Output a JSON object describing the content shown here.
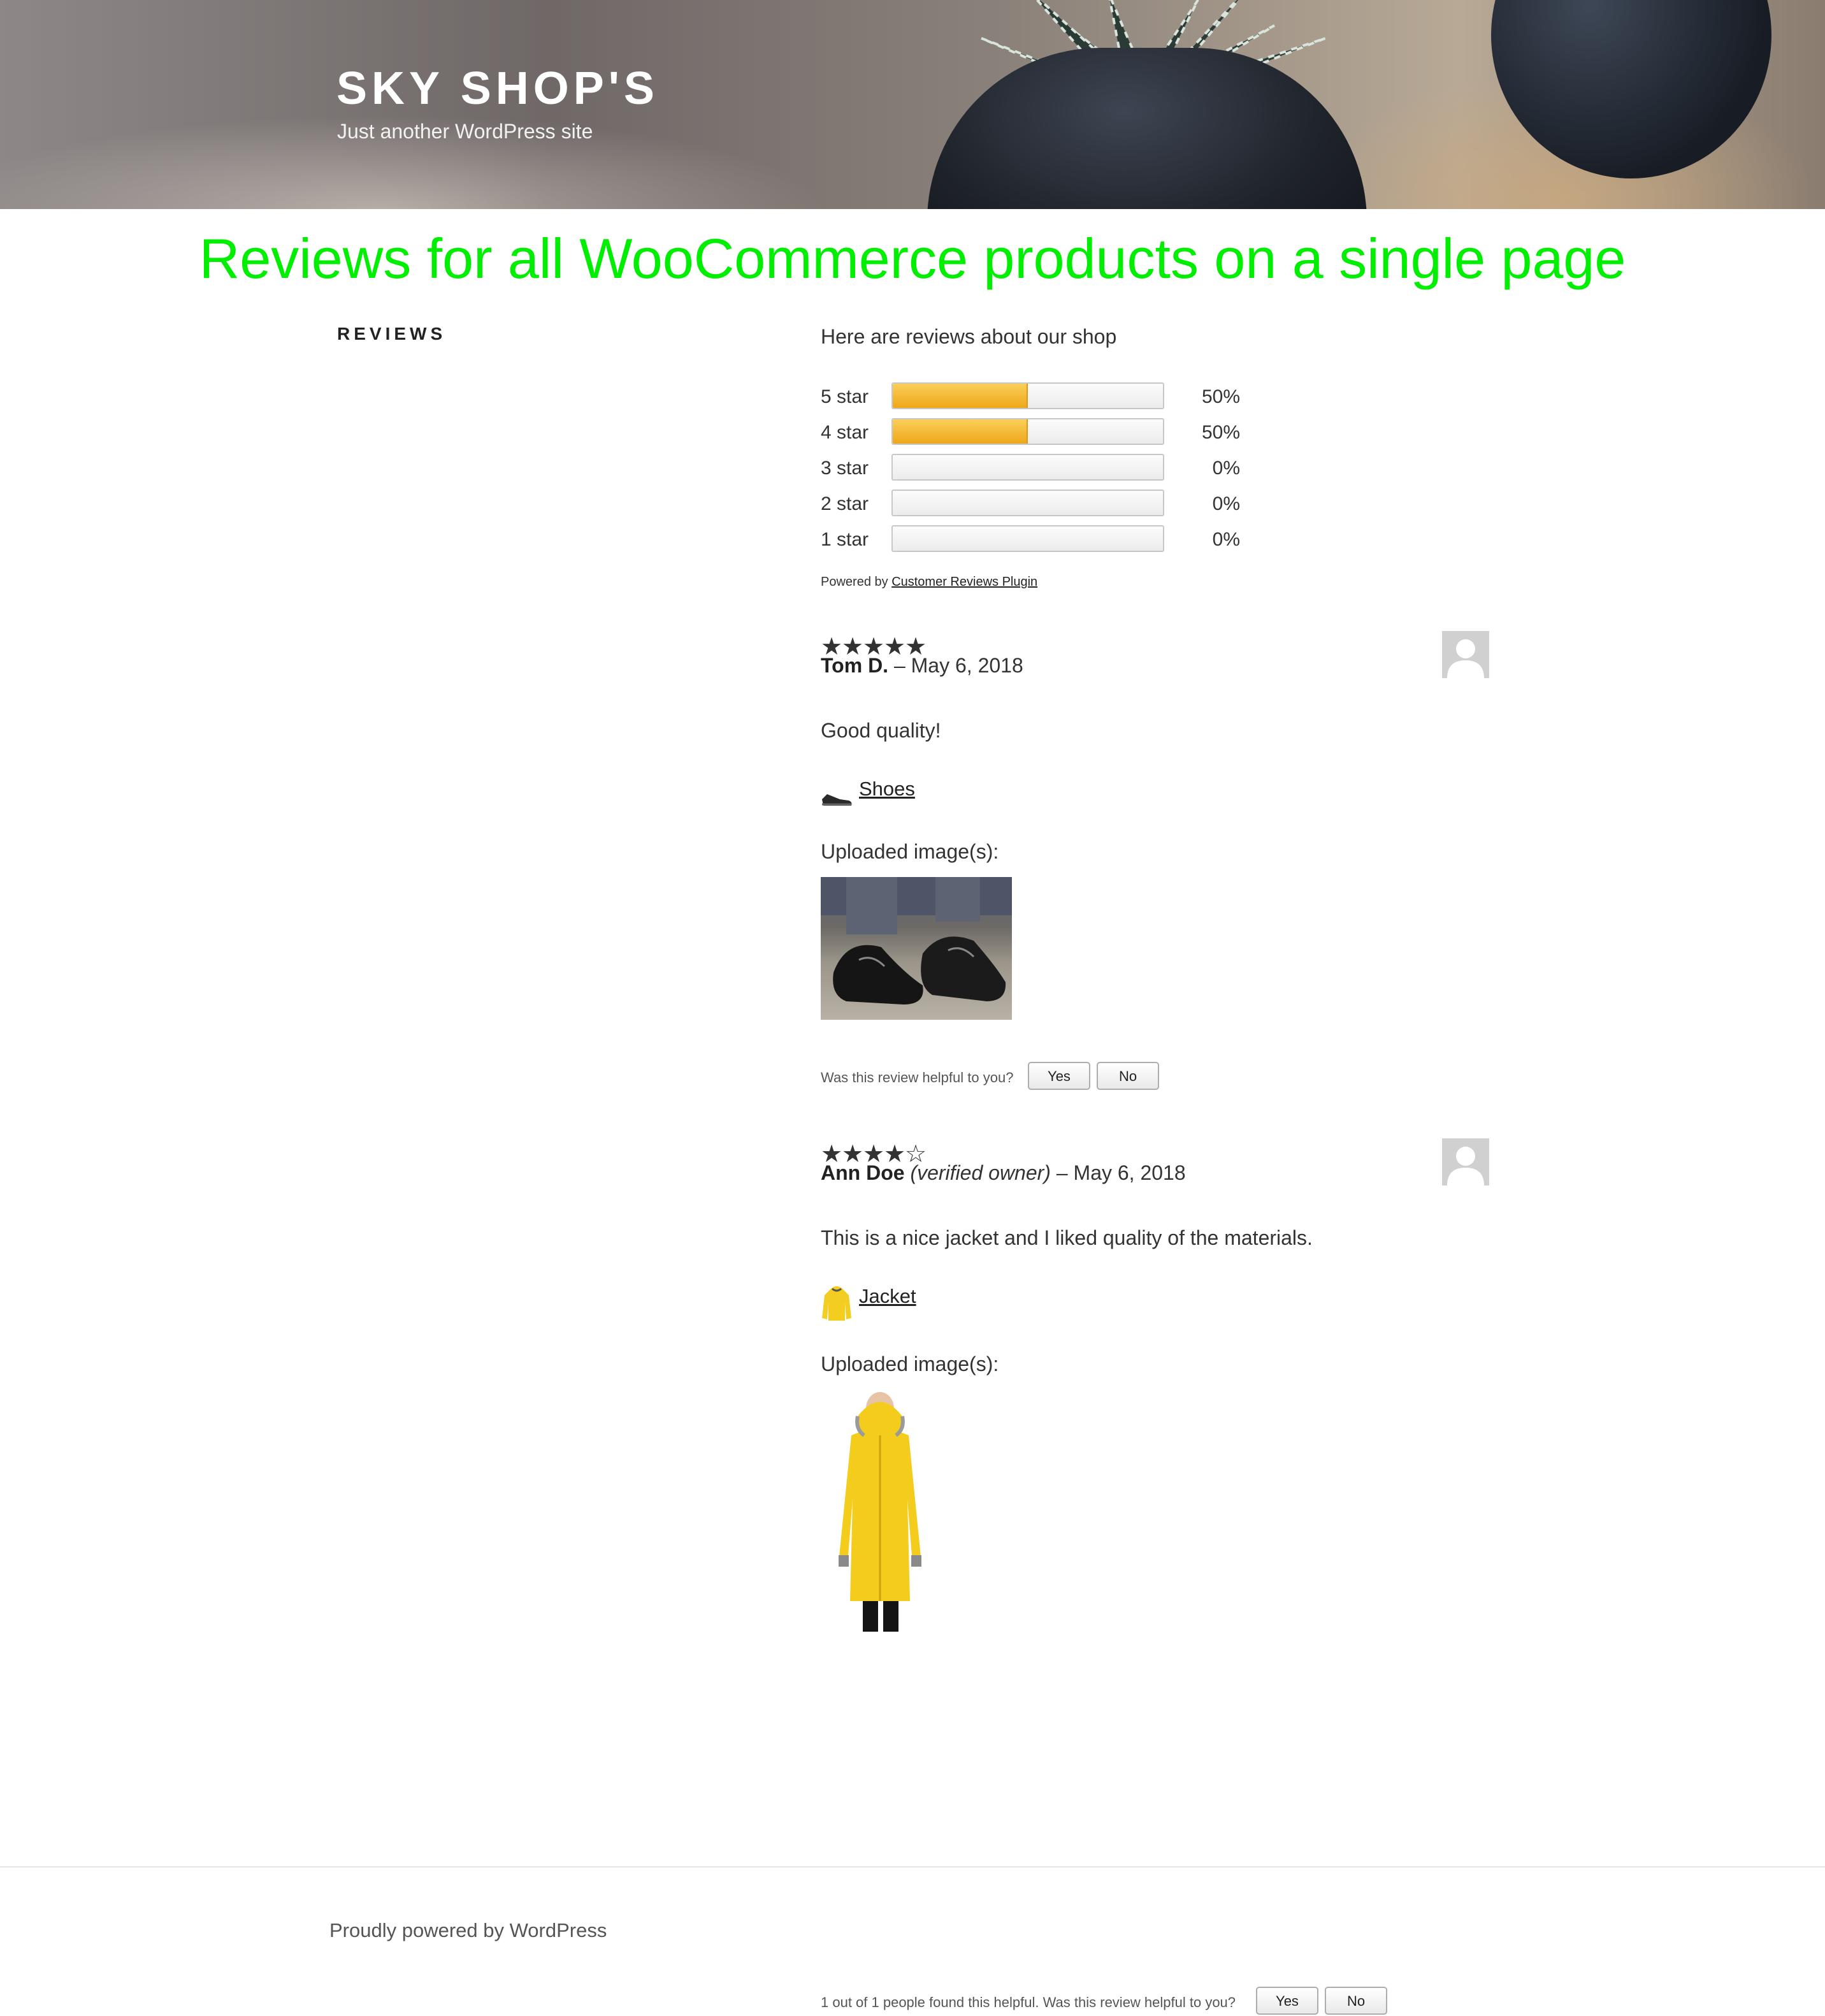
{
  "header": {
    "site_title": "SKY SHOP'S",
    "site_description": "Just another WordPress site"
  },
  "banner": {
    "text": "Reviews for all WooCommerce products on a single page",
    "color": "#00ee00"
  },
  "page": {
    "title": "REVIEWS"
  },
  "summary": {
    "intro": "Here are reviews about our shop",
    "rows": [
      {
        "label": "5 star",
        "percent": 50,
        "percent_text": "50%"
      },
      {
        "label": "4 star",
        "percent": 50,
        "percent_text": "50%"
      },
      {
        "label": "3 star",
        "percent": 0,
        "percent_text": "0%"
      },
      {
        "label": "2 star",
        "percent": 0,
        "percent_text": "0%"
      },
      {
        "label": "1 star",
        "percent": 0,
        "percent_text": "0%"
      }
    ],
    "powered_prefix": "Powered by",
    "powered_link": "Customer Reviews Plugin",
    "bar_color": "#f2b22e"
  },
  "reviews": [
    {
      "rating": 5,
      "author": "Tom D.",
      "verified": "",
      "date": "– May 6, 2018",
      "text": "Good quality!",
      "product": "Shoes",
      "product_icon": "shoe-icon",
      "uploaded_label": "Uploaded image(s):",
      "helpful_text": "Was this review helpful to you?",
      "yes_label": "Yes",
      "no_label": "No"
    },
    {
      "rating": 4,
      "author": "Ann Doe",
      "verified": "(verified owner)",
      "date": "– May 6, 2018",
      "text": "This is a nice jacket and I liked quality of the materials.",
      "product": "Jacket",
      "product_icon": "jacket-icon",
      "uploaded_label": "Uploaded image(s):",
      "helpful_text": "1 out of 1 people found this helpful. Was this review helpful to you?",
      "yes_label": "Yes",
      "no_label": "No"
    }
  ],
  "footer": {
    "text": "Proudly powered by WordPress"
  }
}
